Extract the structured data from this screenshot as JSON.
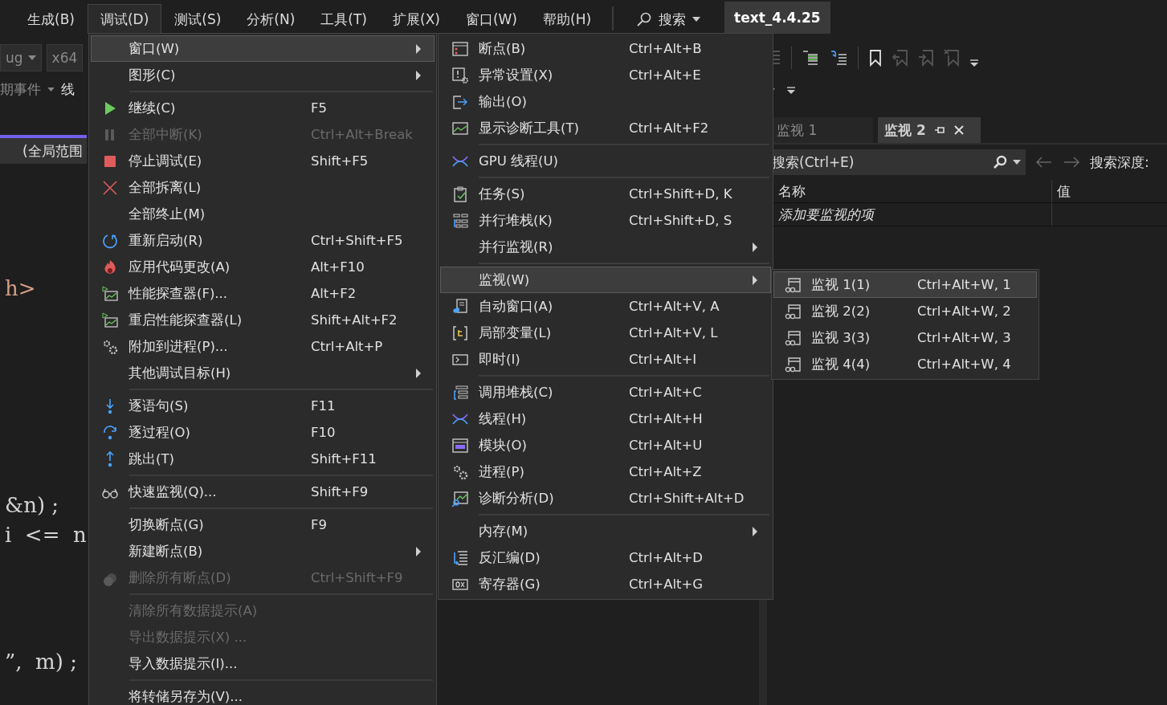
{
  "menubar": {
    "items": [
      {
        "label": "生成(B)",
        "selected": false
      },
      {
        "label": "调试(D)",
        "selected": true
      },
      {
        "label": "测试(S)",
        "selected": false
      },
      {
        "label": "分析(N)",
        "selected": false
      },
      {
        "label": "工具(T)",
        "selected": false
      },
      {
        "label": "扩展(X)",
        "selected": false
      },
      {
        "label": "窗口(W)",
        "selected": false
      },
      {
        "label": "帮助(H)",
        "selected": false
      }
    ],
    "search": "搜索",
    "solution_title": "text_4.4.25"
  },
  "left_pane": {
    "configuration": "ug",
    "platform": "x64",
    "events": "期事件",
    "thread_label": "线",
    "scope": "(全局范围",
    "code_lines": [
      "h>",
      "&n) ;",
      "i  <=  n",
      "”,  m) ;"
    ]
  },
  "debug_menu": {
    "items": [
      {
        "kind": "item",
        "label": "窗口(W)",
        "submenu": true,
        "selected": true,
        "disabled": false
      },
      {
        "kind": "item",
        "label": "图形(C)",
        "submenu": true,
        "selected": false,
        "disabled": false
      },
      {
        "kind": "separator"
      },
      {
        "kind": "item",
        "label": "继续(C)",
        "shortcut": "F5",
        "submenu": false,
        "selected": false,
        "disabled": false
      },
      {
        "kind": "item",
        "label": "全部中断(K)",
        "shortcut": "Ctrl+Alt+Break",
        "submenu": false,
        "selected": false,
        "disabled": true
      },
      {
        "kind": "item",
        "label": "停止调试(E)",
        "shortcut": "Shift+F5",
        "submenu": false,
        "selected": false,
        "disabled": false
      },
      {
        "kind": "item",
        "label": "全部拆离(L)",
        "submenu": false,
        "selected": false,
        "disabled": false
      },
      {
        "kind": "item",
        "label": "全部终止(M)",
        "submenu": false,
        "selected": false,
        "disabled": false
      },
      {
        "kind": "item",
        "label": "重新启动(R)",
        "shortcut": "Ctrl+Shift+F5",
        "submenu": false,
        "selected": false,
        "disabled": false
      },
      {
        "kind": "item",
        "label": "应用代码更改(A)",
        "shortcut": "Alt+F10",
        "submenu": false,
        "selected": false,
        "disabled": false
      },
      {
        "kind": "item",
        "label": "性能探查器(F)...",
        "shortcut": "Alt+F2",
        "submenu": false,
        "selected": false,
        "disabled": false
      },
      {
        "kind": "item",
        "label": "重启性能探查器(L)",
        "shortcut": "Shift+Alt+F2",
        "submenu": false,
        "selected": false,
        "disabled": false
      },
      {
        "kind": "item",
        "label": "附加到进程(P)...",
        "shortcut": "Ctrl+Alt+P",
        "submenu": false,
        "selected": false,
        "disabled": false
      },
      {
        "kind": "item",
        "label": "其他调试目标(H)",
        "submenu": true,
        "selected": false,
        "disabled": false
      },
      {
        "kind": "separator"
      },
      {
        "kind": "item",
        "label": "逐语句(S)",
        "shortcut": "F11",
        "submenu": false,
        "selected": false,
        "disabled": false
      },
      {
        "kind": "item",
        "label": "逐过程(O)",
        "shortcut": "F10",
        "submenu": false,
        "selected": false,
        "disabled": false
      },
      {
        "kind": "item",
        "label": "跳出(T)",
        "shortcut": "Shift+F11",
        "submenu": false,
        "selected": false,
        "disabled": false
      },
      {
        "kind": "separator"
      },
      {
        "kind": "item",
        "label": "快速监视(Q)...",
        "shortcut": "Shift+F9",
        "submenu": false,
        "selected": false,
        "disabled": false
      },
      {
        "kind": "separator"
      },
      {
        "kind": "item",
        "label": "切换断点(G)",
        "shortcut": "F9",
        "submenu": false,
        "selected": false,
        "disabled": false
      },
      {
        "kind": "item",
        "label": "新建断点(B)",
        "submenu": true,
        "selected": false,
        "disabled": false
      },
      {
        "kind": "item",
        "label": "删除所有断点(D)",
        "shortcut": "Ctrl+Shift+F9",
        "submenu": false,
        "selected": false,
        "disabled": true
      },
      {
        "kind": "separator"
      },
      {
        "kind": "item",
        "label": "清除所有数据提示(A)",
        "submenu": false,
        "selected": false,
        "disabled": true
      },
      {
        "kind": "item",
        "label": "导出数据提示(X) ...",
        "submenu": false,
        "selected": false,
        "disabled": true
      },
      {
        "kind": "item",
        "label": "导入数据提示(I)...",
        "submenu": false,
        "selected": false,
        "disabled": false
      },
      {
        "kind": "separator"
      },
      {
        "kind": "item",
        "label": "将转储另存为(V)...",
        "submenu": false,
        "selected": false,
        "disabled": false
      }
    ]
  },
  "window_submenu": {
    "items": [
      {
        "kind": "item",
        "label": "断点(B)",
        "shortcut": "Ctrl+Alt+B",
        "submenu": false,
        "selected": false
      },
      {
        "kind": "item",
        "label": "异常设置(X)",
        "shortcut": "Ctrl+Alt+E",
        "submenu": false,
        "selected": false
      },
      {
        "kind": "item",
        "label": "输出(O)",
        "submenu": false,
        "selected": false
      },
      {
        "kind": "item",
        "label": "显示诊断工具(T)",
        "shortcut": "Ctrl+Alt+F2",
        "submenu": false,
        "selected": false
      },
      {
        "kind": "separator"
      },
      {
        "kind": "item",
        "label": "GPU 线程(U)",
        "submenu": false,
        "selected": false
      },
      {
        "kind": "separator"
      },
      {
        "kind": "item",
        "label": "任务(S)",
        "shortcut": "Ctrl+Shift+D, K",
        "submenu": false,
        "selected": false
      },
      {
        "kind": "item",
        "label": "并行堆栈(K)",
        "shortcut": "Ctrl+Shift+D, S",
        "submenu": false,
        "selected": false
      },
      {
        "kind": "item",
        "label": "并行监视(R)",
        "submenu": true,
        "selected": false
      },
      {
        "kind": "separator"
      },
      {
        "kind": "item",
        "label": "监视(W)",
        "submenu": true,
        "selected": true
      },
      {
        "kind": "item",
        "label": "自动窗口(A)",
        "shortcut": "Ctrl+Alt+V, A",
        "submenu": false,
        "selected": false
      },
      {
        "kind": "item",
        "label": "局部变量(L)",
        "shortcut": "Ctrl+Alt+V, L",
        "submenu": false,
        "selected": false
      },
      {
        "kind": "item",
        "label": "即时(I)",
        "shortcut": "Ctrl+Alt+I",
        "submenu": false,
        "selected": false
      },
      {
        "kind": "separator"
      },
      {
        "kind": "item",
        "label": "调用堆栈(C)",
        "shortcut": "Ctrl+Alt+C",
        "submenu": false,
        "selected": false
      },
      {
        "kind": "item",
        "label": "线程(H)",
        "shortcut": "Ctrl+Alt+H",
        "submenu": false,
        "selected": false
      },
      {
        "kind": "item",
        "label": "模块(O)",
        "shortcut": "Ctrl+Alt+U",
        "submenu": false,
        "selected": false
      },
      {
        "kind": "item",
        "label": "进程(P)",
        "shortcut": "Ctrl+Alt+Z",
        "submenu": false,
        "selected": false
      },
      {
        "kind": "item",
        "label": "诊断分析(D)",
        "shortcut": "Ctrl+Shift+Alt+D",
        "submenu": false,
        "selected": false
      },
      {
        "kind": "separator"
      },
      {
        "kind": "item",
        "label": "内存(M)",
        "submenu": true,
        "selected": false
      },
      {
        "kind": "item",
        "label": "反汇编(D)",
        "shortcut": "Ctrl+Alt+D",
        "submenu": false,
        "selected": false
      },
      {
        "kind": "item",
        "label": "寄存器(G)",
        "shortcut": "Ctrl+Alt+G",
        "submenu": false,
        "selected": false
      }
    ]
  },
  "watch_submenu": {
    "items": [
      {
        "kind": "item",
        "label": "监视 1(1)",
        "shortcut": "Ctrl+Alt+W, 1",
        "submenu": false,
        "selected": true
      },
      {
        "kind": "item",
        "label": "监视 2(2)",
        "shortcut": "Ctrl+Alt+W, 2",
        "submenu": false,
        "selected": false
      },
      {
        "kind": "item",
        "label": "监视 3(3)",
        "shortcut": "Ctrl+Alt+W, 3",
        "submenu": false,
        "selected": false
      },
      {
        "kind": "item",
        "label": "监视 4(4)",
        "shortcut": "Ctrl+Alt+W, 4",
        "submenu": false,
        "selected": false
      }
    ]
  },
  "watch_panel": {
    "tabs": [
      {
        "label": "监视 1",
        "selected": false
      },
      {
        "label": "监视 2",
        "selected": true
      }
    ],
    "search": {
      "placeholder": "搜索(Ctrl+E)"
    },
    "search_depth_label": "搜索深度:",
    "table": {
      "columns": [
        "名称",
        "值"
      ],
      "rows": [
        [
          "添加要监视的项",
          ""
        ]
      ]
    }
  }
}
